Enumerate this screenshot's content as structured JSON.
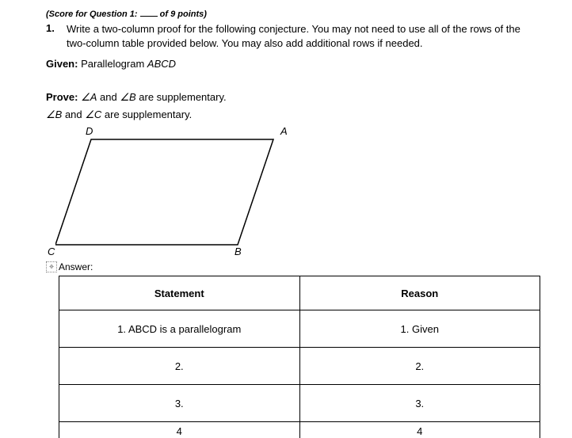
{
  "score": {
    "prefix": "(Score for Question 1:",
    "suffix": " of 9 points)"
  },
  "question": {
    "number": "1.",
    "text": "Write a two-column proof for the following conjecture. You may not need to use all of the rows of the two-column table provided below. You may also add additional rows if needed."
  },
  "given": {
    "label": "Given:",
    "text_pre": "Parallelogram ",
    "text_italic": "ABCD"
  },
  "prove": {
    "label": "Prove:",
    "line1_a": "∠A",
    "line1_mid": " and ",
    "line1_b": "∠B",
    "line1_end": " are supplementary.",
    "line2_b": "∠B",
    "line2_mid": " and ",
    "line2_c": "∠C",
    "line2_end": " are supplementary."
  },
  "figure": {
    "D": "D",
    "A": "A",
    "C": "C",
    "B": "B"
  },
  "answer_label": "Answer:",
  "table": {
    "headers": {
      "statement": "Statement",
      "reason": "Reason"
    },
    "rows": [
      {
        "statement": "1. ABCD is a parallelogram",
        "reason": "1. Given"
      },
      {
        "statement": "2.",
        "reason": "2."
      },
      {
        "statement": "3.",
        "reason": "3."
      },
      {
        "statement": "4",
        "reason": "4"
      }
    ]
  },
  "chart_data": {
    "type": "table",
    "title": "Two-column proof",
    "columns": [
      "Statement",
      "Reason"
    ],
    "rows": [
      [
        "1. ABCD is a parallelogram",
        "1. Given"
      ],
      [
        "2.",
        "2."
      ],
      [
        "3.",
        "3."
      ],
      [
        "4",
        "4"
      ]
    ]
  }
}
